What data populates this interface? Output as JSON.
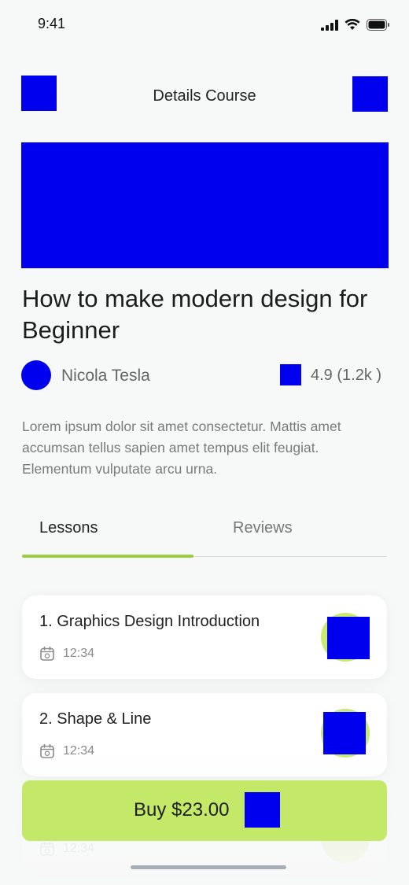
{
  "status_bar": {
    "time": "9:41"
  },
  "header": {
    "title": "Details Course"
  },
  "course": {
    "title": "How to make modern design for Beginner",
    "author": "Nicola Tesla",
    "rating": "4.9 (1.2k )",
    "description": "Lorem ipsum dolor sit amet consectetur. Mattis amet accumsan tellus sapien amet tempus elit feugiat. Elementum vulputate arcu urna."
  },
  "tabs": {
    "lessons": "Lessons",
    "reviews": "Reviews",
    "active": "Lessons"
  },
  "lessons": [
    {
      "title": "1. Graphics Design Introduction",
      "duration": "12:34"
    },
    {
      "title": "2. Shape & Line",
      "duration": "12:34"
    },
    {
      "title": "",
      "duration": "12:34"
    }
  ],
  "buy": {
    "label": "Buy $23.00"
  },
  "colors": {
    "accent": "#c4e968",
    "tab_indicator": "#9ccc3f",
    "placeholder": "#0000ee"
  }
}
